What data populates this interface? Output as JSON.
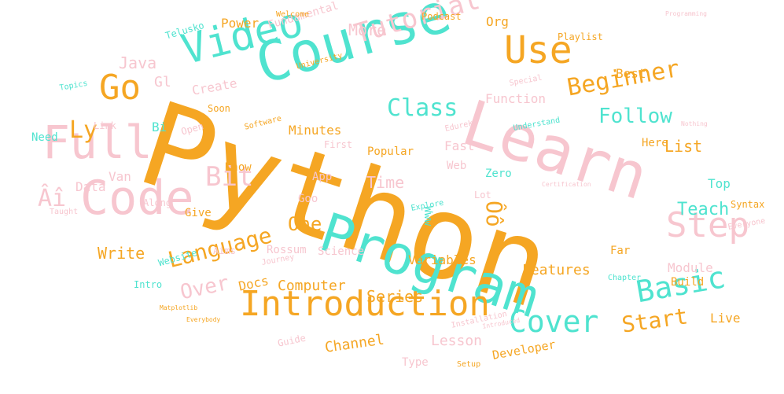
{
  "colors": {
    "orange": "#f5a623",
    "teal": "#4fe3cf",
    "pink": "#f7c6cf",
    "background": "#ffffff"
  },
  "words": [
    {
      "text": "Python",
      "color": "orange"
    },
    {
      "text": "Learn",
      "color": "pink"
    },
    {
      "text": "Program",
      "color": "teal"
    },
    {
      "text": "Course",
      "color": "teal"
    },
    {
      "text": "Code",
      "color": "pink"
    },
    {
      "text": "Introduction",
      "color": "orange"
    },
    {
      "text": "Full",
      "color": "pink"
    },
    {
      "text": "Video",
      "color": "teal"
    },
    {
      "text": "Step",
      "color": "pink"
    },
    {
      "text": "Use",
      "color": "orange"
    },
    {
      "text": "Basic",
      "color": "teal"
    },
    {
      "text": "Tutorial",
      "color": "pink"
    },
    {
      "text": "Go",
      "color": "orange"
    },
    {
      "text": "Language",
      "color": "orange"
    },
    {
      "text": "Cover",
      "color": "teal"
    },
    {
      "text": "Start",
      "color": "orange"
    },
    {
      "text": "Beginner",
      "color": "orange"
    },
    {
      "text": "Class",
      "color": "teal"
    },
    {
      "text": "Follow",
      "color": "teal"
    },
    {
      "text": "Bit",
      "color": "pink"
    },
    {
      "text": "Ly",
      "color": "orange"
    },
    {
      "text": "Âî",
      "color": "pink"
    },
    {
      "text": "Ôô",
      "color": "orange"
    },
    {
      "text": "Teach",
      "color": "teal"
    },
    {
      "text": "One",
      "color": "orange"
    },
    {
      "text": "Time",
      "color": "pink"
    },
    {
      "text": "Write",
      "color": "orange"
    },
    {
      "text": "Over",
      "color": "pink"
    },
    {
      "text": "Series",
      "color": "orange"
    },
    {
      "text": "Computer",
      "color": "orange"
    },
    {
      "text": "Features",
      "color": "orange"
    },
    {
      "text": "Channel",
      "color": "orange"
    },
    {
      "text": "Lesson",
      "color": "pink"
    },
    {
      "text": "Developer",
      "color": "orange"
    },
    {
      "text": "Java",
      "color": "pink"
    },
    {
      "text": "More",
      "color": "pink"
    },
    {
      "text": "Power",
      "color": "orange"
    },
    {
      "text": "Fundamental",
      "color": "pink"
    },
    {
      "text": "Org",
      "color": "orange"
    },
    {
      "text": "Podcast",
      "color": "orange"
    },
    {
      "text": "Playlist",
      "color": "orange"
    },
    {
      "text": "Welcome",
      "color": "orange"
    },
    {
      "text": "Telusko",
      "color": "teal"
    },
    {
      "text": "Gl",
      "color": "pink"
    },
    {
      "text": "Create",
      "color": "pink"
    },
    {
      "text": "Soon",
      "color": "orange"
    },
    {
      "text": "Topics",
      "color": "teal"
    },
    {
      "text": "Need",
      "color": "teal"
    },
    {
      "text": "Link",
      "color": "pink"
    },
    {
      "text": "Bi",
      "color": "teal"
    },
    {
      "text": "Open",
      "color": "pink"
    },
    {
      "text": "Minutes",
      "color": "orange"
    },
    {
      "text": "Software",
      "color": "orange"
    },
    {
      "text": "First",
      "color": "pink"
    },
    {
      "text": "Popular",
      "color": "orange"
    },
    {
      "text": "Fast",
      "color": "pink"
    },
    {
      "text": "Web",
      "color": "pink"
    },
    {
      "text": "Zero",
      "color": "teal"
    },
    {
      "text": "Lot",
      "color": "pink"
    },
    {
      "text": "Here",
      "color": "orange"
    },
    {
      "text": "List",
      "color": "orange"
    },
    {
      "text": "Top",
      "color": "teal"
    },
    {
      "text": "Syntax",
      "color": "orange"
    },
    {
      "text": "Everyone",
      "color": "pink"
    },
    {
      "text": "Best",
      "color": "orange"
    },
    {
      "text": "Function",
      "color": "pink"
    },
    {
      "text": "Special",
      "color": "pink"
    },
    {
      "text": "Understand",
      "color": "teal"
    },
    {
      "text": "Edureka",
      "color": "pink"
    },
    {
      "text": "Nothing",
      "color": "pink"
    },
    {
      "text": "Certification",
      "color": "pink"
    },
    {
      "text": "University",
      "color": "orange"
    },
    {
      "text": "Data",
      "color": "pink"
    },
    {
      "text": "Van",
      "color": "pink"
    },
    {
      "text": "Know",
      "color": "orange"
    },
    {
      "text": "App",
      "color": "pink"
    },
    {
      "text": "Goo",
      "color": "pink"
    },
    {
      "text": "Www",
      "color": "teal"
    },
    {
      "text": "Explore",
      "color": "teal"
    },
    {
      "text": "Along",
      "color": "pink"
    },
    {
      "text": "Give",
      "color": "orange"
    },
    {
      "text": "Taught",
      "color": "pink"
    },
    {
      "text": "Aims",
      "color": "pink"
    },
    {
      "text": "Rossum",
      "color": "pink"
    },
    {
      "text": "Science",
      "color": "pink"
    },
    {
      "text": "Variables",
      "color": "orange"
    },
    {
      "text": "Website",
      "color": "teal"
    },
    {
      "text": "Intro",
      "color": "teal"
    },
    {
      "text": "Journey",
      "color": "pink"
    },
    {
      "text": "Docs",
      "color": "orange"
    },
    {
      "text": "Matplotlib",
      "color": "orange"
    },
    {
      "text": "Everybody",
      "color": "orange"
    },
    {
      "text": "Guide",
      "color": "pink"
    },
    {
      "text": "Type",
      "color": "pink"
    },
    {
      "text": "Installation",
      "color": "pink"
    },
    {
      "text": "Introduced",
      "color": "pink"
    },
    {
      "text": "Setup",
      "color": "orange"
    },
    {
      "text": "Chapter",
      "color": "teal"
    },
    {
      "text": "Module",
      "color": "pink"
    },
    {
      "text": "Build",
      "color": "orange"
    },
    {
      "text": "Live",
      "color": "orange"
    },
    {
      "text": "Far",
      "color": "orange"
    },
    {
      "text": "Programming",
      "color": "pink"
    }
  ]
}
